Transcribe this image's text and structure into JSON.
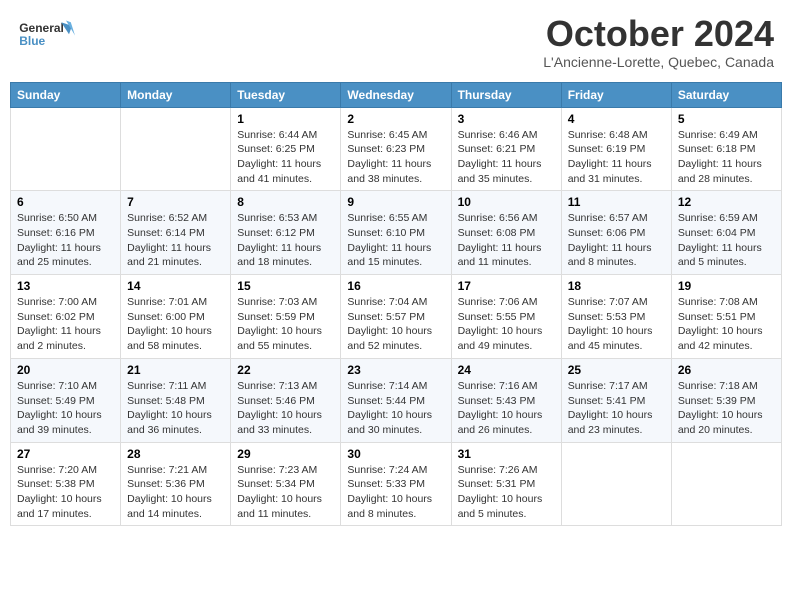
{
  "header": {
    "logo": {
      "general": "General",
      "blue": "Blue",
      "alt": "GeneralBlue logo"
    },
    "title": "October 2024",
    "location": "L'Ancienne-Lorette, Quebec, Canada"
  },
  "days_of_week": [
    "Sunday",
    "Monday",
    "Tuesday",
    "Wednesday",
    "Thursday",
    "Friday",
    "Saturday"
  ],
  "weeks": [
    [
      {
        "day": "",
        "info": ""
      },
      {
        "day": "",
        "info": ""
      },
      {
        "day": "1",
        "sunrise": "Sunrise: 6:44 AM",
        "sunset": "Sunset: 6:25 PM",
        "daylight": "Daylight: 11 hours and 41 minutes."
      },
      {
        "day": "2",
        "sunrise": "Sunrise: 6:45 AM",
        "sunset": "Sunset: 6:23 PM",
        "daylight": "Daylight: 11 hours and 38 minutes."
      },
      {
        "day": "3",
        "sunrise": "Sunrise: 6:46 AM",
        "sunset": "Sunset: 6:21 PM",
        "daylight": "Daylight: 11 hours and 35 minutes."
      },
      {
        "day": "4",
        "sunrise": "Sunrise: 6:48 AM",
        "sunset": "Sunset: 6:19 PM",
        "daylight": "Daylight: 11 hours and 31 minutes."
      },
      {
        "day": "5",
        "sunrise": "Sunrise: 6:49 AM",
        "sunset": "Sunset: 6:18 PM",
        "daylight": "Daylight: 11 hours and 28 minutes."
      }
    ],
    [
      {
        "day": "6",
        "sunrise": "Sunrise: 6:50 AM",
        "sunset": "Sunset: 6:16 PM",
        "daylight": "Daylight: 11 hours and 25 minutes."
      },
      {
        "day": "7",
        "sunrise": "Sunrise: 6:52 AM",
        "sunset": "Sunset: 6:14 PM",
        "daylight": "Daylight: 11 hours and 21 minutes."
      },
      {
        "day": "8",
        "sunrise": "Sunrise: 6:53 AM",
        "sunset": "Sunset: 6:12 PM",
        "daylight": "Daylight: 11 hours and 18 minutes."
      },
      {
        "day": "9",
        "sunrise": "Sunrise: 6:55 AM",
        "sunset": "Sunset: 6:10 PM",
        "daylight": "Daylight: 11 hours and 15 minutes."
      },
      {
        "day": "10",
        "sunrise": "Sunrise: 6:56 AM",
        "sunset": "Sunset: 6:08 PM",
        "daylight": "Daylight: 11 hours and 11 minutes."
      },
      {
        "day": "11",
        "sunrise": "Sunrise: 6:57 AM",
        "sunset": "Sunset: 6:06 PM",
        "daylight": "Daylight: 11 hours and 8 minutes."
      },
      {
        "day": "12",
        "sunrise": "Sunrise: 6:59 AM",
        "sunset": "Sunset: 6:04 PM",
        "daylight": "Daylight: 11 hours and 5 minutes."
      }
    ],
    [
      {
        "day": "13",
        "sunrise": "Sunrise: 7:00 AM",
        "sunset": "Sunset: 6:02 PM",
        "daylight": "Daylight: 11 hours and 2 minutes."
      },
      {
        "day": "14",
        "sunrise": "Sunrise: 7:01 AM",
        "sunset": "Sunset: 6:00 PM",
        "daylight": "Daylight: 10 hours and 58 minutes."
      },
      {
        "day": "15",
        "sunrise": "Sunrise: 7:03 AM",
        "sunset": "Sunset: 5:59 PM",
        "daylight": "Daylight: 10 hours and 55 minutes."
      },
      {
        "day": "16",
        "sunrise": "Sunrise: 7:04 AM",
        "sunset": "Sunset: 5:57 PM",
        "daylight": "Daylight: 10 hours and 52 minutes."
      },
      {
        "day": "17",
        "sunrise": "Sunrise: 7:06 AM",
        "sunset": "Sunset: 5:55 PM",
        "daylight": "Daylight: 10 hours and 49 minutes."
      },
      {
        "day": "18",
        "sunrise": "Sunrise: 7:07 AM",
        "sunset": "Sunset: 5:53 PM",
        "daylight": "Daylight: 10 hours and 45 minutes."
      },
      {
        "day": "19",
        "sunrise": "Sunrise: 7:08 AM",
        "sunset": "Sunset: 5:51 PM",
        "daylight": "Daylight: 10 hours and 42 minutes."
      }
    ],
    [
      {
        "day": "20",
        "sunrise": "Sunrise: 7:10 AM",
        "sunset": "Sunset: 5:49 PM",
        "daylight": "Daylight: 10 hours and 39 minutes."
      },
      {
        "day": "21",
        "sunrise": "Sunrise: 7:11 AM",
        "sunset": "Sunset: 5:48 PM",
        "daylight": "Daylight: 10 hours and 36 minutes."
      },
      {
        "day": "22",
        "sunrise": "Sunrise: 7:13 AM",
        "sunset": "Sunset: 5:46 PM",
        "daylight": "Daylight: 10 hours and 33 minutes."
      },
      {
        "day": "23",
        "sunrise": "Sunrise: 7:14 AM",
        "sunset": "Sunset: 5:44 PM",
        "daylight": "Daylight: 10 hours and 30 minutes."
      },
      {
        "day": "24",
        "sunrise": "Sunrise: 7:16 AM",
        "sunset": "Sunset: 5:43 PM",
        "daylight": "Daylight: 10 hours and 26 minutes."
      },
      {
        "day": "25",
        "sunrise": "Sunrise: 7:17 AM",
        "sunset": "Sunset: 5:41 PM",
        "daylight": "Daylight: 10 hours and 23 minutes."
      },
      {
        "day": "26",
        "sunrise": "Sunrise: 7:18 AM",
        "sunset": "Sunset: 5:39 PM",
        "daylight": "Daylight: 10 hours and 20 minutes."
      }
    ],
    [
      {
        "day": "27",
        "sunrise": "Sunrise: 7:20 AM",
        "sunset": "Sunset: 5:38 PM",
        "daylight": "Daylight: 10 hours and 17 minutes."
      },
      {
        "day": "28",
        "sunrise": "Sunrise: 7:21 AM",
        "sunset": "Sunset: 5:36 PM",
        "daylight": "Daylight: 10 hours and 14 minutes."
      },
      {
        "day": "29",
        "sunrise": "Sunrise: 7:23 AM",
        "sunset": "Sunset: 5:34 PM",
        "daylight": "Daylight: 10 hours and 11 minutes."
      },
      {
        "day": "30",
        "sunrise": "Sunrise: 7:24 AM",
        "sunset": "Sunset: 5:33 PM",
        "daylight": "Daylight: 10 hours and 8 minutes."
      },
      {
        "day": "31",
        "sunrise": "Sunrise: 7:26 AM",
        "sunset": "Sunset: 5:31 PM",
        "daylight": "Daylight: 10 hours and 5 minutes."
      },
      {
        "day": "",
        "info": ""
      },
      {
        "day": "",
        "info": ""
      }
    ]
  ]
}
